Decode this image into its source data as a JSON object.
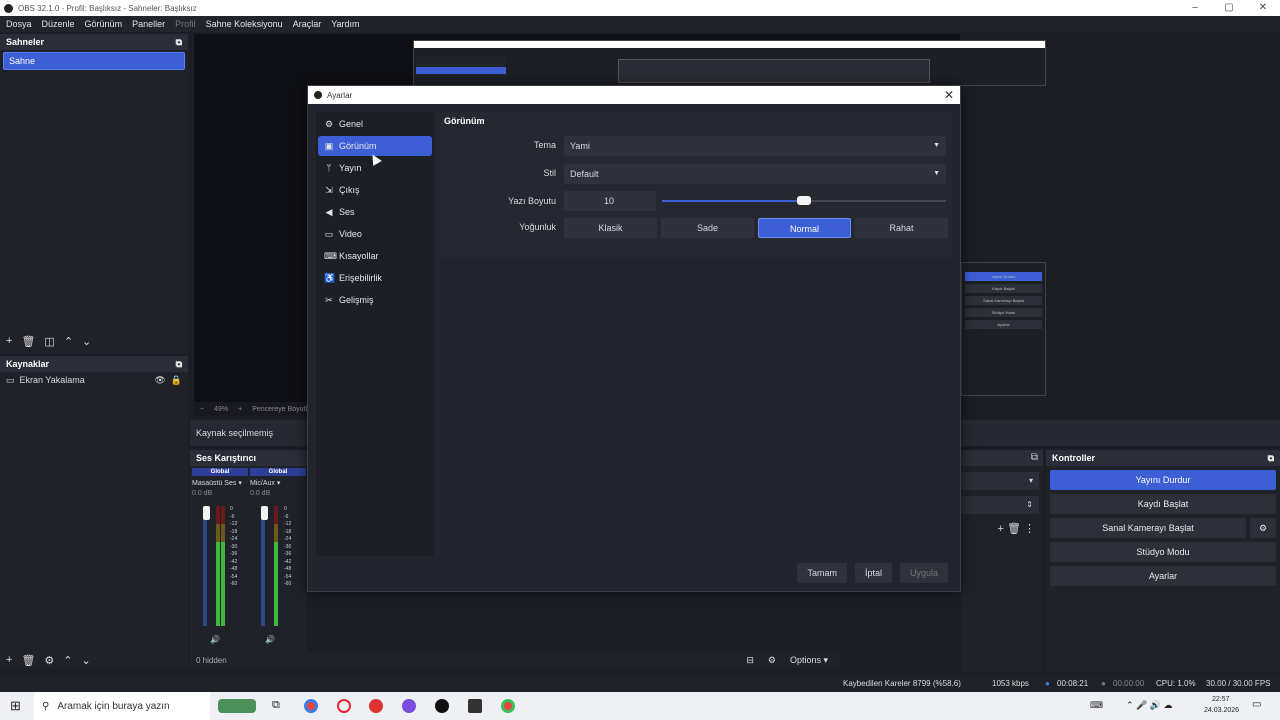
{
  "window": {
    "title": "OBS 32.1.0 - Profil: Başlıksız - Sahneler: Başlıksız",
    "controls": [
      "–",
      "▢",
      "✕"
    ]
  },
  "menu": [
    "Dosya",
    "Düzenle",
    "Görünüm",
    "Paneller",
    "Profil",
    "Sahne Koleksiyonu",
    "Araçlar",
    "Yardım"
  ],
  "scenes": {
    "title": "Sahneler",
    "items": [
      "Sahne"
    ]
  },
  "sources": {
    "title": "Kaynaklar",
    "items": [
      "Ekran Yakalama"
    ]
  },
  "zoom": {
    "minus": "−",
    "value": "49%",
    "plus": "+",
    "fit": "Pencereye Boyutla"
  },
  "no_source": "Kaynak seçilmemiş",
  "mixer": {
    "title": "Ses Karıştırıcı",
    "channels": [
      {
        "global": "Global",
        "name": "Masaüstü Ses",
        "db": "0.0 dB"
      },
      {
        "global": "Global",
        "name": "Mic/Aux",
        "db": "0.0 dB"
      }
    ],
    "ticks": [
      "0",
      "-6",
      "-12",
      "-18",
      "-24",
      "-30",
      "-36",
      "-42",
      "-48",
      "-54",
      "-60"
    ]
  },
  "bottom": {
    "hidden": "0 hidden",
    "options": "Options"
  },
  "controls": {
    "title": "Kontroller",
    "stream": "Yayını Durdur",
    "record": "Kaydı Başlat",
    "vcam": "Sanal Kamerayı Başlat",
    "studio": "Stüdyo Modu",
    "settings": "Ayarlar"
  },
  "status": {
    "dropped": "Kaybedilen Kareler 8799 (%58.6)",
    "bitrate": "1053 kbps",
    "stream_time": "00:08:21",
    "rec_time": "00:00:00",
    "cpu": "CPU: 1.0%",
    "fps": "30.00 / 30.00 FPS"
  },
  "taskbar": {
    "search": "Aramak için buraya yazın",
    "time": "22:57",
    "date": "24.03.2026"
  },
  "nested": {
    "buttons": [
      "Yayını Durdur",
      "Kaydı Başlat",
      "Sanal Kamerayı Başlat",
      "Stüdyo Modu",
      "Ayarlar"
    ]
  },
  "dialog": {
    "title": "Ayarlar",
    "nav": [
      {
        "label": "Genel",
        "icon": "gear-icon"
      },
      {
        "label": "Görünüm",
        "icon": "appearance-icon"
      },
      {
        "label": "Yayın",
        "icon": "antenna-icon"
      },
      {
        "label": "Çıkış",
        "icon": "output-icon"
      },
      {
        "label": "Ses",
        "icon": "speaker-icon"
      },
      {
        "label": "Video",
        "icon": "monitor-icon"
      },
      {
        "label": "Kısayollar",
        "icon": "keyboard-icon"
      },
      {
        "label": "Erişebilirlik",
        "icon": "accessibility-icon"
      },
      {
        "label": "Gelişmiş",
        "icon": "tools-icon"
      }
    ],
    "section": "Görünüm",
    "theme_label": "Tema",
    "theme_value": "Yami",
    "style_label": "Stil",
    "style_value": "Default",
    "font_label": "Yazı Boyutu",
    "font_value": "10",
    "font_slider_fraction": 0.5,
    "density_label": "Yoğunluk",
    "density": [
      "Klasik",
      "Sade",
      "Normal",
      "Rahat"
    ],
    "density_selected": "Normal",
    "ok": "Tamam",
    "cancel": "İptal",
    "apply": "Uygula"
  },
  "colors": {
    "accent": "#3c5fd6",
    "background": "#1c1e26"
  }
}
